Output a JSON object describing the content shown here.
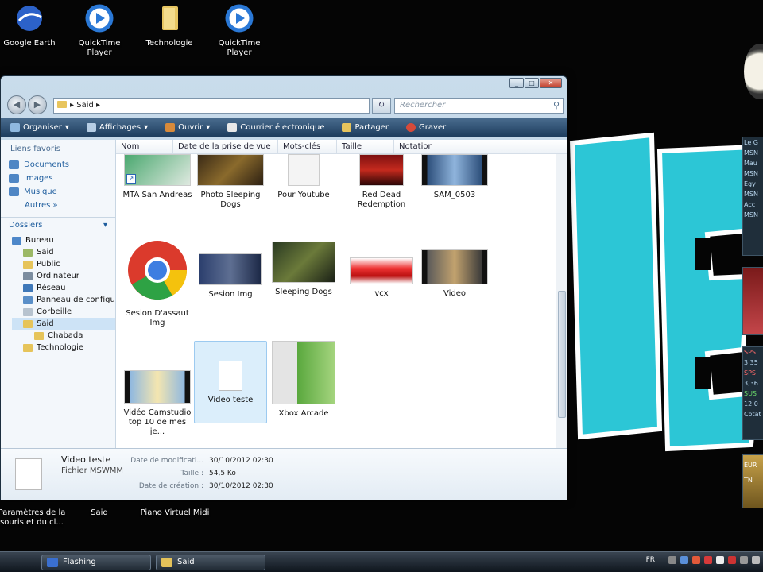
{
  "desktop": {
    "icons_top": [
      {
        "label": "Google Earth",
        "icon": "google-earth-icon"
      },
      {
        "label": "QuickTime Player",
        "icon": "quicktime-icon"
      },
      {
        "label": "Technologie",
        "icon": "folder-icon"
      },
      {
        "label": "QuickTime Player",
        "icon": "quicktime-icon"
      }
    ],
    "icons_bottom": [
      {
        "label": "Paramètres de la souris et du cl..."
      },
      {
        "label": "Said"
      },
      {
        "label": "Piano Virtuel Midi"
      }
    ],
    "gadgets": {
      "feed_lines": [
        "Le G",
        "MSN",
        "Mau",
        "MSN",
        "Egy",
        "MSN",
        "Acc",
        "MSN"
      ],
      "stock_lines": [
        "SPS",
        "3,35",
        "SPS",
        "3,36",
        "SUS",
        "12.0",
        "Cotat"
      ],
      "card_lines": [
        "EUR",
        "TN"
      ]
    }
  },
  "window": {
    "address": {
      "path": "Said",
      "separator": "▸"
    },
    "search_placeholder": "Rechercher",
    "toolbar": [
      "Organiser",
      "Affichages",
      "Ouvrir",
      "Courrier électronique",
      "Partager",
      "Graver"
    ],
    "nav": {
      "favorites_header": "Liens favoris",
      "favorites": [
        "Documents",
        "Images",
        "Musique"
      ],
      "more": "Autres »",
      "folders_header": "Dossiers",
      "tree": [
        {
          "label": "Bureau",
          "depth": 0
        },
        {
          "label": "Said",
          "depth": 1
        },
        {
          "label": "Public",
          "depth": 1
        },
        {
          "label": "Ordinateur",
          "depth": 1
        },
        {
          "label": "Réseau",
          "depth": 1
        },
        {
          "label": "Panneau de configu",
          "depth": 1
        },
        {
          "label": "Corbeille",
          "depth": 1
        },
        {
          "label": "Said",
          "depth": 1,
          "selected": true
        },
        {
          "label": "Chabada",
          "depth": 2
        },
        {
          "label": "Technologie",
          "depth": 1
        }
      ]
    },
    "columns": [
      "Nom",
      "Date de la prise de vue",
      "Mots-clés",
      "Taille",
      "Notation"
    ],
    "files": [
      {
        "name": "MTA San Andreas",
        "kind": "shortcut"
      },
      {
        "name": "Photo Sleeping Dogs",
        "kind": "image"
      },
      {
        "name": "Pour Youtube",
        "kind": "doc"
      },
      {
        "name": "Red Dead Redemption",
        "kind": "image"
      },
      {
        "name": "SAM_0503",
        "kind": "video"
      },
      {
        "name": "Sesion D'assaut Img",
        "kind": "chrome"
      },
      {
        "name": "Sesion Img",
        "kind": "image"
      },
      {
        "name": "Sleeping Dogs",
        "kind": "image"
      },
      {
        "name": "vcx",
        "kind": "image"
      },
      {
        "name": "Video",
        "kind": "video"
      },
      {
        "name": "Vidéo Camstudio top 10 de mes je...",
        "kind": "video"
      },
      {
        "name": "Video teste",
        "kind": "doc",
        "selected": true
      },
      {
        "name": "Xbox Arcade",
        "kind": "image"
      }
    ],
    "details": {
      "name": "Video teste",
      "type": "Fichier MSWMM",
      "fields": [
        {
          "label": "Date de modificati...",
          "value": "30/10/2012 02:30"
        },
        {
          "label": "Taille :",
          "value": "54,5 Ko"
        },
        {
          "label": "Date de création :",
          "value": "30/10/2012 02:30"
        }
      ]
    }
  },
  "taskbar": {
    "buttons": [
      "Flashing",
      "Said"
    ],
    "lang": "FR"
  }
}
